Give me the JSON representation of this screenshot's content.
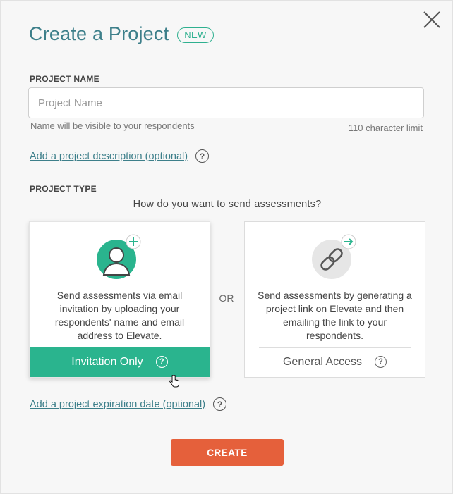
{
  "dialog": {
    "title": "Create a Project",
    "badge": "NEW"
  },
  "project_name": {
    "label": "PROJECT NAME",
    "placeholder": "Project Name",
    "value": "",
    "hint": "Name will be visible to your respondents",
    "limit_text": "110 character limit"
  },
  "description_link": {
    "label": "Add a project description (optional)",
    "help_icon": "?"
  },
  "project_type": {
    "label": "PROJECT TYPE",
    "question": "How do you want to send assessments?",
    "separator": "OR",
    "options": [
      {
        "title": "Invitation Only",
        "description": "Send assessments via email invitation by uploading your respondents' name and email address to Elevate.",
        "icon": "user-plus-icon",
        "selected": true,
        "help_icon": "?"
      },
      {
        "title": "General Access",
        "description": "Send assessments by generating a project link on Elevate and then emailing the link to your respondents.",
        "icon": "link-icon",
        "selected": false,
        "help_icon": "?"
      }
    ]
  },
  "expiration_link": {
    "label": "Add a project expiration date (optional)",
    "help_icon": "?"
  },
  "create_button": {
    "label": "CREATE"
  },
  "colors": {
    "accent_teal": "#2ab48e",
    "title_blue": "#3d7f8a",
    "create_orange": "#e5603b"
  }
}
